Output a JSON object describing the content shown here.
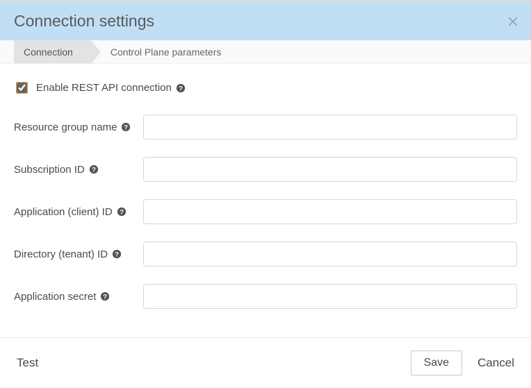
{
  "modal": {
    "title": "Connection settings"
  },
  "tabs": {
    "connection": "Connection",
    "control_plane": "Control Plane parameters"
  },
  "checkbox": {
    "label": "Enable REST API connection",
    "checked": true
  },
  "fields": {
    "resource_group": {
      "label": "Resource group name",
      "value": ""
    },
    "subscription_id": {
      "label": "Subscription ID",
      "value": ""
    },
    "app_client_id": {
      "label": "Application (client) ID",
      "value": ""
    },
    "dir_tenant_id": {
      "label": "Directory (tenant) ID",
      "value": ""
    },
    "app_secret": {
      "label": "Application secret",
      "value": ""
    }
  },
  "footer": {
    "test": "Test",
    "save": "Save",
    "cancel": "Cancel"
  }
}
